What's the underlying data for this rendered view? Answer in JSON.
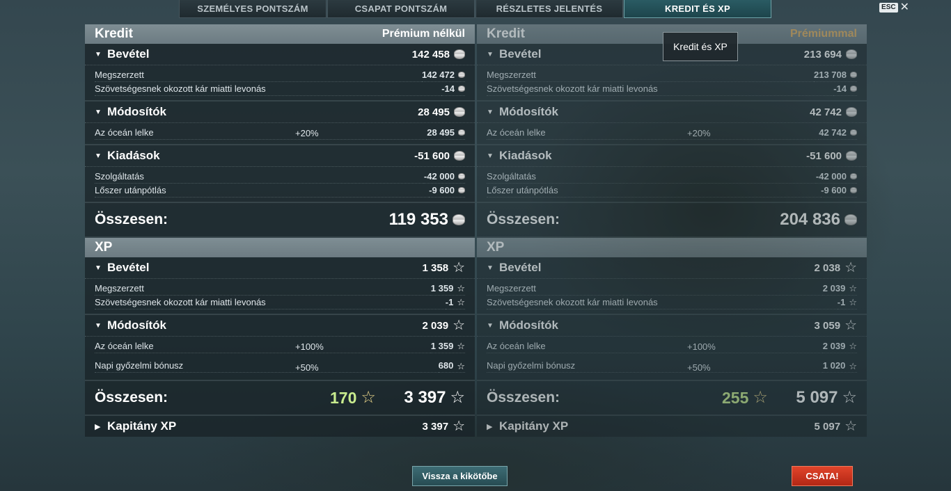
{
  "tabs": [
    {
      "label": "SZEMÉLYES PONTSZÁM"
    },
    {
      "label": "CSAPAT PONTSZÁM"
    },
    {
      "label": "RÉSZLETES JELENTÉS"
    },
    {
      "label": "KREDIT ÉS XP"
    }
  ],
  "esc": {
    "label": "ESC",
    "close": "✕"
  },
  "tooltip": "Kredit és XP",
  "left": {
    "credit_title": "Kredit",
    "credit_tag": "Prémium nélkül",
    "income": {
      "label": "Bevétel",
      "value": "142 458"
    },
    "earned": {
      "label": "Megszerzett",
      "value": "142 472"
    },
    "penalty": {
      "label": "Szövetségesnek okozott kár miatti levonás",
      "value": "-14"
    },
    "modifiers": {
      "label": "Módosítók",
      "value": "28 495"
    },
    "soul": {
      "label": "Az óceán lelke",
      "pct": "+20%",
      "value": "28 495"
    },
    "expenses": {
      "label": "Kiadások",
      "value": "-51 600"
    },
    "service": {
      "label": "Szolgáltatás",
      "value": "-42 000"
    },
    "ammo": {
      "label": "Lőszer utánpótlás",
      "value": "-9 600"
    },
    "total_label": "Összesen:",
    "total_value": "119 353",
    "xp_title": "XP",
    "xp_income": {
      "label": "Bevétel",
      "value": "1 358"
    },
    "xp_earned": {
      "label": "Megszerzett",
      "value": "1 359"
    },
    "xp_penalty": {
      "label": "Szövetségesnek okozott kár miatti levonás",
      "value": "-1"
    },
    "xp_modifiers": {
      "label": "Módosítók",
      "value": "2 039"
    },
    "xp_soul": {
      "label": "Az óceán lelke",
      "pct": "+100%",
      "value": "1 359"
    },
    "xp_daily": {
      "label": "Napi győzelmi bónusz",
      "pct": "+50%",
      "value": "680"
    },
    "xp_total_label": "Összesen:",
    "xp_bonus": "170",
    "xp_total": "3 397",
    "captain": {
      "label": "Kapitány XP",
      "value": "3 397"
    }
  },
  "right": {
    "credit_title": "Kredit",
    "credit_tag": "Prémiummal",
    "income": {
      "label": "Bevétel",
      "value": "213 694"
    },
    "earned": {
      "label": "Megszerzett",
      "value": "213 708"
    },
    "penalty": {
      "label": "Szövetségesnek okozott kár miatti levonás",
      "value": "-14"
    },
    "modifiers": {
      "label": "Módosítók",
      "value": "42 742"
    },
    "soul": {
      "label": "Az óceán lelke",
      "pct": "+20%",
      "value": "42 742"
    },
    "expenses": {
      "label": "Kiadások",
      "value": "-51 600"
    },
    "service": {
      "label": "Szolgáltatás",
      "value": "-42 000"
    },
    "ammo": {
      "label": "Lőszer utánpótlás",
      "value": "-9 600"
    },
    "total_label": "Összesen:",
    "total_value": "204 836",
    "xp_title": "XP",
    "xp_income": {
      "label": "Bevétel",
      "value": "2 038"
    },
    "xp_earned": {
      "label": "Megszerzett",
      "value": "2 039"
    },
    "xp_penalty": {
      "label": "Szövetségesnek okozott kár miatti levonás",
      "value": "-1"
    },
    "xp_modifiers": {
      "label": "Módosítók",
      "value": "3 059"
    },
    "xp_soul": {
      "label": "Az óceán lelke",
      "pct": "+100%",
      "value": "2 039"
    },
    "xp_daily": {
      "label": "Napi győzelmi bónusz",
      "pct": "+50%",
      "value": "1 020"
    },
    "xp_total_label": "Összesen:",
    "xp_bonus": "255",
    "xp_total": "5 097",
    "captain": {
      "label": "Kapitány XP",
      "value": "5 097"
    }
  },
  "buttons": {
    "back": "Vissza a kikötőbe",
    "battle": "CSATA!"
  },
  "icons": {
    "credit": "coin-icon",
    "xp": "star-icon",
    "collapse": "triangle-down-icon",
    "expand": "triangle-right-icon"
  },
  "colors": {
    "active_tab": "#2a5b63",
    "premium": "#e0b062",
    "bonus_xp": "#c8eb8e",
    "battle_button": "#c7301a"
  }
}
